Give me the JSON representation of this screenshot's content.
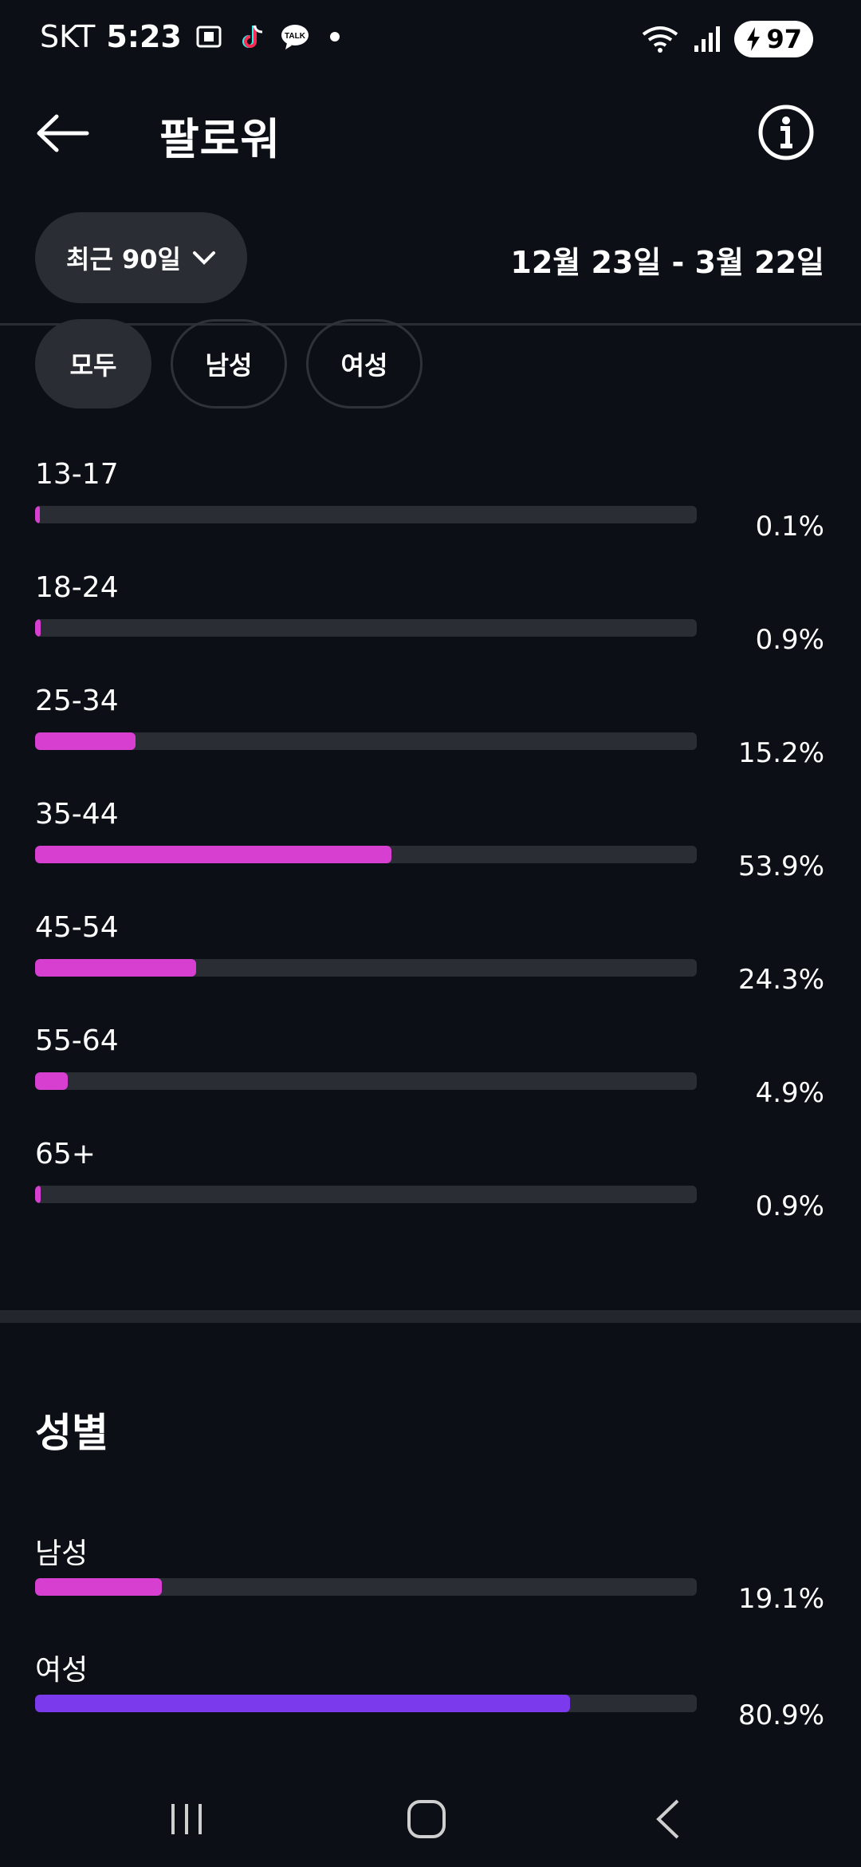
{
  "status_bar": {
    "carrier": "SKT",
    "time": "5:23",
    "battery": "97"
  },
  "header": {
    "title": "팔로워"
  },
  "filters": {
    "period_label": "최근 90일",
    "date_range": "12월 23일 - 3월 22일"
  },
  "tabs": [
    {
      "label": "모두",
      "active": true
    },
    {
      "label": "남성",
      "active": false
    },
    {
      "label": "여성",
      "active": false
    }
  ],
  "age_chart": {
    "type": "bar",
    "categories": [
      "13-17",
      "18-24",
      "25-34",
      "35-44",
      "45-54",
      "55-64",
      "65+"
    ],
    "values": [
      0.1,
      0.9,
      15.2,
      53.9,
      24.3,
      4.9,
      0.9
    ],
    "value_labels": [
      "0.1%",
      "0.9%",
      "15.2%",
      "53.9%",
      "24.3%",
      "4.9%",
      "0.9%"
    ]
  },
  "gender_section": {
    "title": "성별",
    "categories": [
      "남성",
      "여성"
    ],
    "values": [
      19.1,
      80.9
    ],
    "value_labels": [
      "19.1%",
      "80.9%"
    ],
    "colors": [
      "#d63fcf",
      "#7c3aed"
    ]
  },
  "colors": {
    "accent": "#d63fcf",
    "accent_secondary": "#7c3aed",
    "track": "#2a2d33",
    "background": "#0c0f15"
  }
}
